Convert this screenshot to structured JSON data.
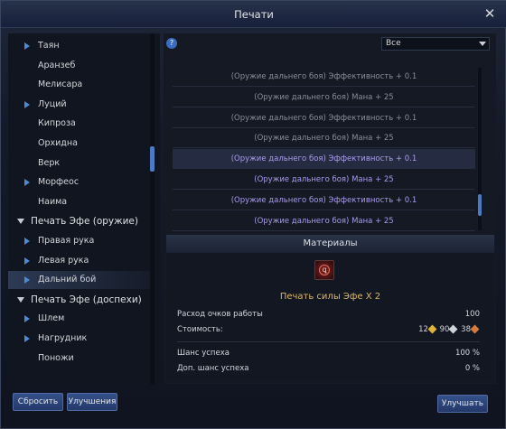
{
  "window": {
    "title": "Печати"
  },
  "tree": {
    "items_top": [
      {
        "label": "Таян",
        "arrow": true
      },
      {
        "label": "Аранзеб",
        "arrow": false
      },
      {
        "label": "Мелисара",
        "arrow": false
      },
      {
        "label": "Луций",
        "arrow": true
      },
      {
        "label": "Кипроза",
        "arrow": false
      },
      {
        "label": "Орхидна",
        "arrow": false
      },
      {
        "label": "Верк",
        "arrow": false
      },
      {
        "label": "Морфеос",
        "arrow": true
      },
      {
        "label": "Наима",
        "arrow": false
      }
    ],
    "group1": {
      "label": "Печать Эфе (оружие)",
      "items": [
        {
          "label": "Правая рука",
          "arrow": true
        },
        {
          "label": "Левая рука",
          "arrow": true
        },
        {
          "label": "Дальний бой",
          "arrow": true,
          "selected": true
        }
      ]
    },
    "group2": {
      "label": "Печать Эфе (доспехи)",
      "items": [
        {
          "label": "Шлем",
          "arrow": true
        },
        {
          "label": "Нагрудник",
          "arrow": true
        },
        {
          "label": "Поножи",
          "arrow": false
        }
      ]
    }
  },
  "filter": {
    "help": "?",
    "selected": "Все"
  },
  "effects": [
    "(Оружие дальнего боя) Эффективность + 0.1",
    "(Оружие дальнего боя) Мана + 25",
    "(Оружие дальнего боя) Эффективность + 0.1",
    "(Оружие дальнего боя) Мана + 25",
    "(Оружие дальнего боя) Эффективность + 0.1",
    "(Оружие дальнего боя) Мана + 25",
    "(Оружие дальнего боя) Эффективность + 0.1",
    "(Оружие дальнего боя) Мана + 25"
  ],
  "materials": {
    "header": "Материалы",
    "item_name": "Печать силы Эфе X 2",
    "work_points_label": "Расход очков работы",
    "work_points_value": "100",
    "cost_label": "Стоимость:",
    "cost_gold": "12",
    "cost_silver": "90",
    "cost_copper": "38",
    "colors": {
      "gold": "#e0b33a",
      "silver": "#cfd3da",
      "copper": "#d47a3e"
    },
    "success_label": "Шанс успеха",
    "success_value": "100 %",
    "bonus_label": "Доп. шанс успеха",
    "bonus_value": "0 %"
  },
  "buttons": {
    "reset": "Сбросить",
    "upgrades": "Улучшения",
    "improve": "Улучшать"
  }
}
